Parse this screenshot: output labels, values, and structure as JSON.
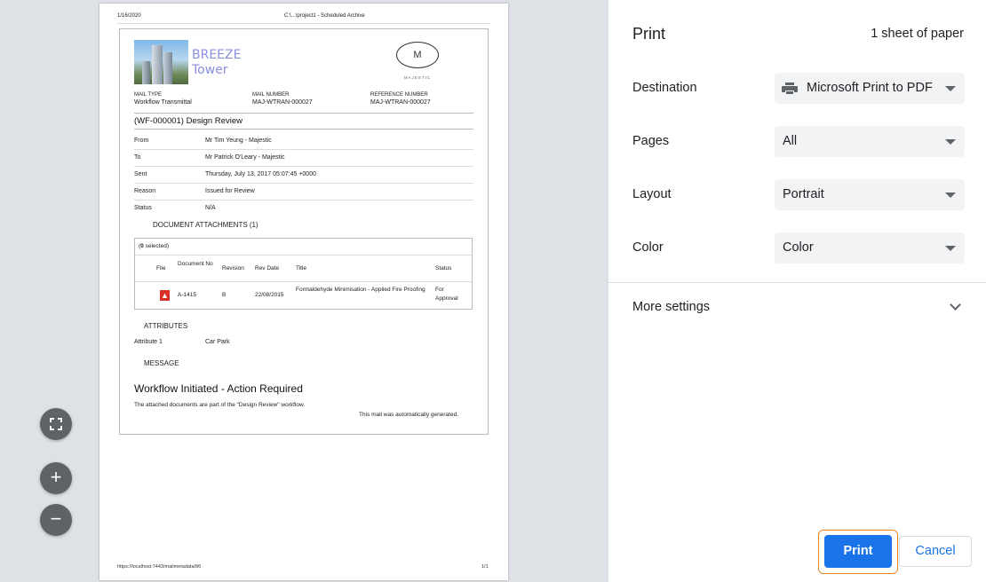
{
  "preview": {
    "header_date": "1/16/2020",
    "header_title": "C:\\...\\project1 - Scheduled Archive",
    "footer_url": "https://localhost:7443/mailmetadata/86",
    "footer_page": "1/1",
    "mail": {
      "brand_line1": "BREEZE",
      "brand_line2": "Tower",
      "logo_letter": "M",
      "logo_word": "MAJESTIC",
      "mail_type_label": "MAIL TYPE",
      "mail_type_value": "Workflow Transmittal",
      "mail_number_label": "MAIL NUMBER",
      "mail_number_value": "MAJ-WTRAN-000027",
      "reference_label": "REFERENCE NUMBER",
      "reference_value": "MAJ-WTRAN-000027",
      "subject": "(WF-000001) Design Review",
      "fields": [
        {
          "label": "From",
          "value": "Mr Tim Yeung - Majestic"
        },
        {
          "label": "To",
          "value": "Mr Patrick O'Leary - Majestic"
        },
        {
          "label": "Sent",
          "value": "Thursday, July 13, 2017 05:07:45 +0000"
        },
        {
          "label": "Reason",
          "value": "Issued for Review"
        },
        {
          "label": "Status",
          "value": "N/A"
        }
      ],
      "attachments_heading": "DOCUMENT ATTACHMENTS (1)",
      "selected_count": "0",
      "selected_suffix": " selected)",
      "selected_prefix": "(",
      "columns": [
        "File",
        "Document No",
        "Revision",
        "Rev Date",
        "Title",
        "Status"
      ],
      "rows": [
        {
          "doc_no": "A-1415",
          "revision": "B",
          "rev_date": "22/08/2015",
          "title": "Formaldehyde Minimisation - Applied Fire Proofing",
          "status": "For Approval"
        }
      ],
      "attributes_heading": "ATTRIBUTES",
      "attribute_label": "Attribute 1",
      "attribute_value": "Car Park",
      "message_heading": "MESSAGE",
      "message_title": "Workflow Initiated - Action Required",
      "message_body": "The attached documents are part of the \"Design Review\" workflow.",
      "auto_note": "This mail was automatically generated."
    },
    "zoom": {
      "fit": "fit-to-page-icon",
      "plus": "+",
      "minus": "−"
    }
  },
  "panel": {
    "title": "Print",
    "sheets": "1 sheet of paper",
    "destination_label": "Destination",
    "destination_value": "Microsoft Print to PDF",
    "pages_label": "Pages",
    "pages_value": "All",
    "layout_label": "Layout",
    "layout_value": "Portrait",
    "color_label": "Color",
    "color_value": "Color",
    "more_settings": "More settings",
    "print_button": "Print",
    "cancel_button": "Cancel"
  },
  "colors": {
    "accent": "#1a73e8",
    "focus": "#e8862a",
    "pdf_icon": "#d93025",
    "preview_bg": "#dee1e6"
  }
}
